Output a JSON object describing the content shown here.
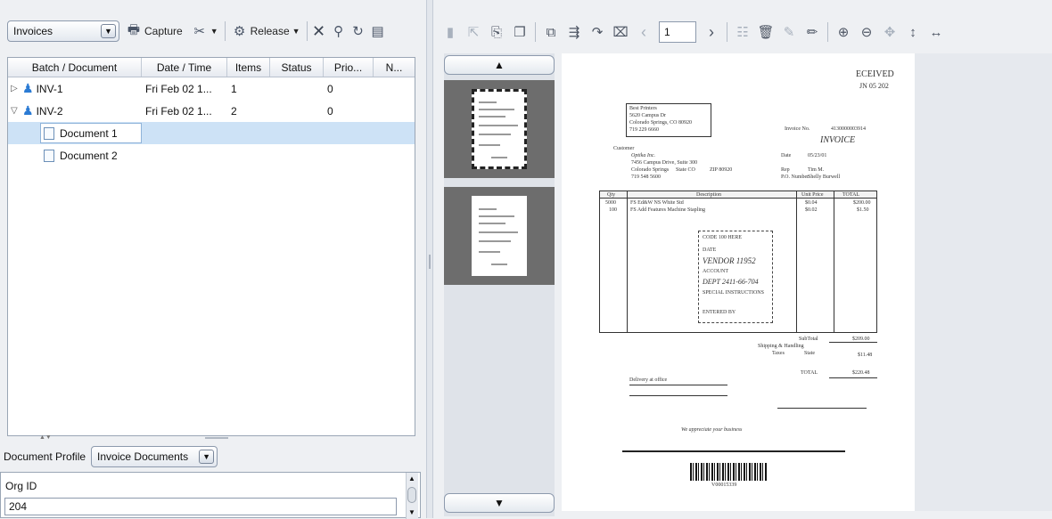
{
  "left_toolbar": {
    "batch_type": "Invoices",
    "capture_label": "Capture",
    "release_label": "Release"
  },
  "tree": {
    "columns": [
      "Batch / Document",
      "Date / Time",
      "Items",
      "Status",
      "Prio...",
      "N..."
    ],
    "rows": [
      {
        "name": "INV-1",
        "date": "Fri Feb 02 1...",
        "items": "1",
        "status": "",
        "priority": "0"
      },
      {
        "name": "INV-2",
        "date": "Fri Feb 02 1...",
        "items": "2",
        "status": "",
        "priority": "0"
      }
    ],
    "documents": [
      "Document 1",
      "Document 2"
    ]
  },
  "profile": {
    "label": "Document Profile",
    "value": "Invoice Documents"
  },
  "org": {
    "label": "Org ID",
    "value": "204"
  },
  "right_toolbar": {
    "page_number": "1"
  },
  "invoice": {
    "received": "ECEIVED",
    "received_date": "JN 05 202",
    "from_lines": [
      "Best Printers",
      "5620 Campus Dr",
      "Colorado Springs, CO 80920",
      "719 229 6660"
    ],
    "invoice_no_label": "Invoice No.",
    "invoice_no": "4130000003914",
    "title": "INVOICE",
    "customer_label": "Customer",
    "customer_name": "Optika Inc.",
    "customer_address": "7456 Campus Drive, Suite 300",
    "customer_city": "Colorado Springs",
    "customer_state": "State CO",
    "customer_zip": "ZIP 80920",
    "customer_phone": "719 548 5600",
    "date_label": "Date",
    "date": "05/23/01",
    "rep_label": "Rep",
    "rep": "Tim M.",
    "po_label": "P.O. Number",
    "po": "Shelly Burwell",
    "headers": [
      "Qty",
      "Description",
      "Unit Price",
      "TOTAL"
    ],
    "lines": [
      {
        "qty": "5000",
        "desc": "FS Ed&W NS White Std",
        "unit": "$0.04",
        "total": "$200.00"
      },
      {
        "qty": "100",
        "desc": "FS Add Features Machine Stapling",
        "unit": "$0.02",
        "total": "$1.50"
      }
    ],
    "stamp_lines": [
      "CODE 100 HERE",
      "DATE",
      "VENDOR 11952",
      "ACCOUNT",
      "DEPT 2411-66-704",
      "SPECIAL INSTRUCTIONS",
      "ENTERED BY"
    ],
    "subtotal_label": "SubTotal",
    "subtotal": "$209.00",
    "shipping_label": "Shipping & Handling",
    "taxes_label": "Taxes",
    "taxes_state": "State",
    "taxes": "$11.48",
    "total_label": "TOTAL",
    "total": "$220.48",
    "delivery": "Delivery at office",
    "footer": "We appreciate your business",
    "barcode_number": "V00015339"
  }
}
